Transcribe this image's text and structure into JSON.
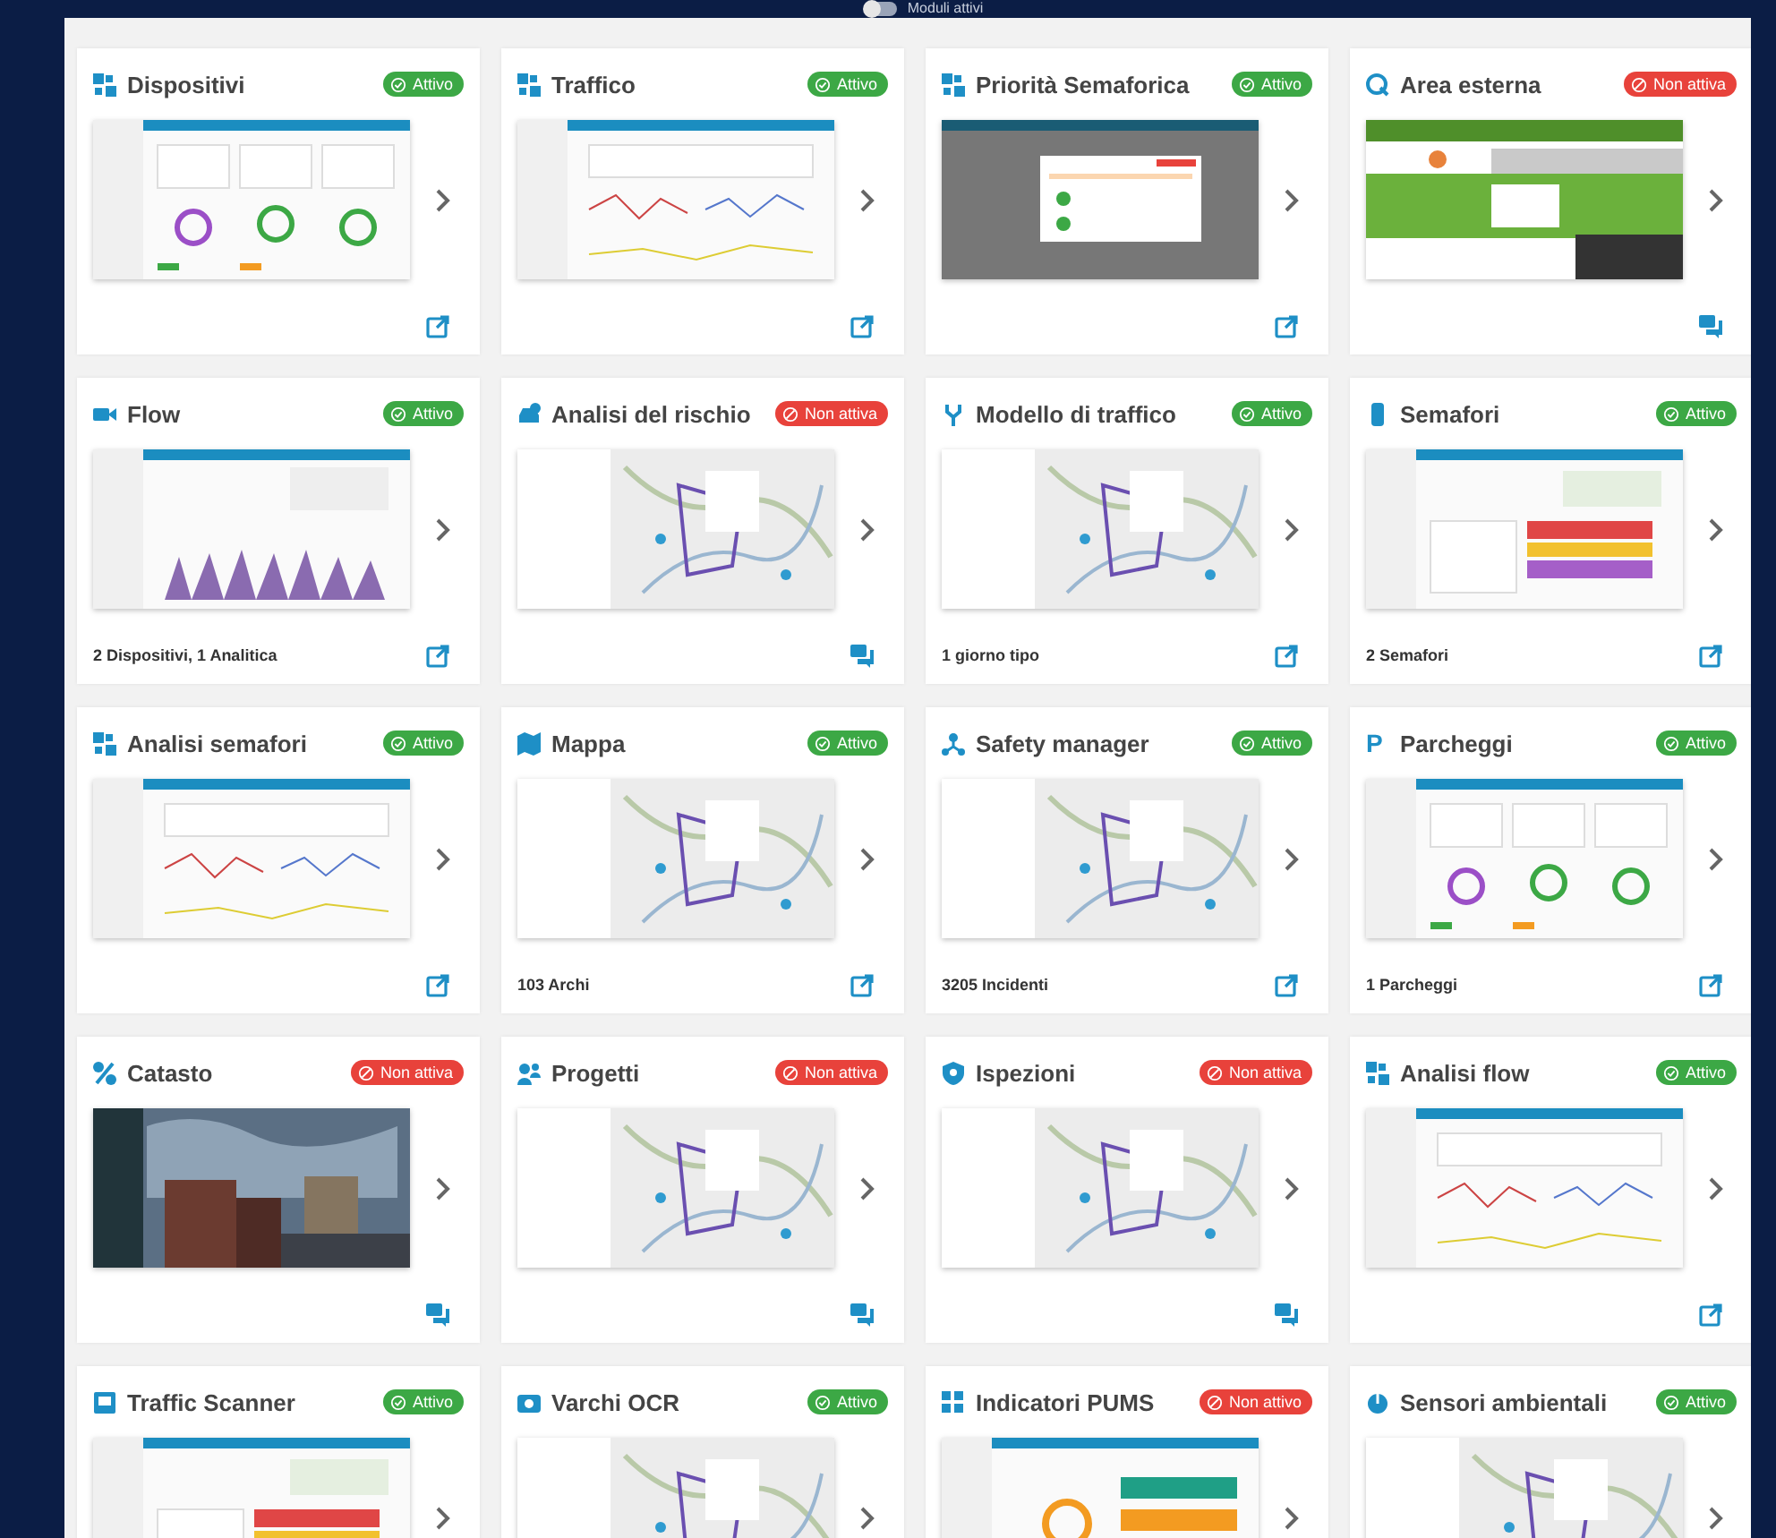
{
  "filter": {
    "label": "Moduli attivi",
    "on": false
  },
  "modules": [
    {
      "title": "Dispositivi",
      "active": true,
      "badge": "Attivo"
    },
    {
      "title": "Traffico",
      "active": true,
      "badge": "Attivo"
    },
    {
      "title": "Priorità Semaforica",
      "active": true,
      "badge": "Attivo"
    },
    {
      "title": "Area esterna",
      "active": false,
      "badge": "Non attiva"
    },
    {
      "title": "Flow",
      "active": true,
      "badge": "Attivo",
      "footer": "2 Dispositivi, 1 Analitica"
    },
    {
      "title": "Analisi del rischio",
      "active": false,
      "badge": "Non attiva"
    },
    {
      "title": "Modello di traffico",
      "active": true,
      "badge": "Attivo",
      "footer": "1 giorno tipo"
    },
    {
      "title": "Semafori",
      "active": true,
      "badge": "Attivo",
      "footer": "2 Semafori"
    },
    {
      "title": "Analisi semafori",
      "active": true,
      "badge": "Attivo"
    },
    {
      "title": "Mappa",
      "active": true,
      "badge": "Attivo",
      "footer": "103 Archi"
    },
    {
      "title": "Safety manager",
      "active": true,
      "badge": "Attivo",
      "footer": "3205 Incidenti"
    },
    {
      "title": "Parcheggi",
      "glyph": "P",
      "active": true,
      "badge": "Attivo",
      "footer": "1 Parcheggi"
    },
    {
      "title": "Catasto",
      "active": false,
      "badge": "Non attiva"
    },
    {
      "title": "Progetti",
      "active": false,
      "badge": "Non attiva"
    },
    {
      "title": "Ispezioni",
      "active": false,
      "badge": "Non attiva"
    },
    {
      "title": "Analisi flow",
      "active": true,
      "badge": "Attivo"
    },
    {
      "title": "Traffic Scanner",
      "active": true,
      "badge": "Attivo"
    },
    {
      "title": "Varchi OCR",
      "active": true,
      "badge": "Attivo"
    },
    {
      "title": "Indicatori PUMS",
      "active": false,
      "badge": "Non attivo"
    },
    {
      "title": "Sensori ambientali",
      "active": true,
      "badge": "Attivo"
    }
  ]
}
